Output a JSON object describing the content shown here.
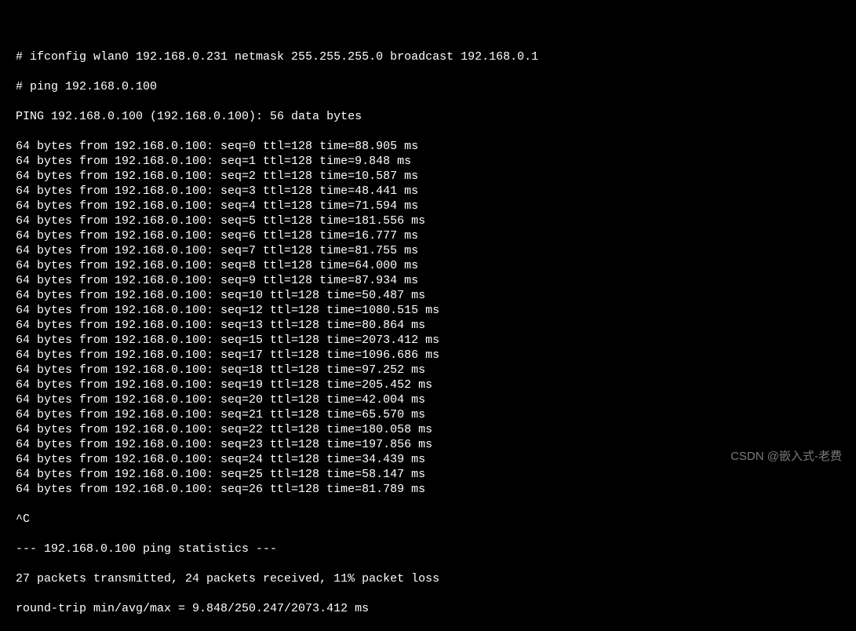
{
  "commands": {
    "ifconfig": "# ifconfig wlan0 192.168.0.231 netmask 255.255.255.0 broadcast 192.168.0.1",
    "ping": "# ping 192.168.0.100"
  },
  "ping_header": "PING 192.168.0.100 (192.168.0.100): 56 data bytes",
  "replies": [
    {
      "seq": 0,
      "ttl": 128,
      "time": "88.905"
    },
    {
      "seq": 1,
      "ttl": 128,
      "time": "9.848"
    },
    {
      "seq": 2,
      "ttl": 128,
      "time": "10.587"
    },
    {
      "seq": 3,
      "ttl": 128,
      "time": "48.441"
    },
    {
      "seq": 4,
      "ttl": 128,
      "time": "71.594"
    },
    {
      "seq": 5,
      "ttl": 128,
      "time": "181.556"
    },
    {
      "seq": 6,
      "ttl": 128,
      "time": "16.777"
    },
    {
      "seq": 7,
      "ttl": 128,
      "time": "81.755"
    },
    {
      "seq": 8,
      "ttl": 128,
      "time": "64.000"
    },
    {
      "seq": 9,
      "ttl": 128,
      "time": "87.934"
    },
    {
      "seq": 10,
      "ttl": 128,
      "time": "50.487"
    },
    {
      "seq": 12,
      "ttl": 128,
      "time": "1080.515"
    },
    {
      "seq": 13,
      "ttl": 128,
      "time": "80.864"
    },
    {
      "seq": 15,
      "ttl": 128,
      "time": "2073.412"
    },
    {
      "seq": 17,
      "ttl": 128,
      "time": "1096.686"
    },
    {
      "seq": 18,
      "ttl": 128,
      "time": "97.252"
    },
    {
      "seq": 19,
      "ttl": 128,
      "time": "205.452"
    },
    {
      "seq": 20,
      "ttl": 128,
      "time": "42.004"
    },
    {
      "seq": 21,
      "ttl": 128,
      "time": "65.570"
    },
    {
      "seq": 22,
      "ttl": 128,
      "time": "180.058"
    },
    {
      "seq": 23,
      "ttl": 128,
      "time": "197.856"
    },
    {
      "seq": 24,
      "ttl": 128,
      "time": "34.439"
    },
    {
      "seq": 25,
      "ttl": 128,
      "time": "58.147"
    },
    {
      "seq": 26,
      "ttl": 128,
      "time": "81.789"
    }
  ],
  "reply_template": {
    "bytes": "64",
    "from": "192.168.0.100",
    "unit": "ms"
  },
  "interrupt": "^C",
  "stats": {
    "header": "--- 192.168.0.100 ping statistics ---",
    "summary": "27 packets transmitted, 24 packets received, 11% packet loss",
    "rtt": "round-trip min/avg/max = 9.848/250.247/2073.412 ms"
  },
  "watermark": "CSDN @嵌入式-老费"
}
